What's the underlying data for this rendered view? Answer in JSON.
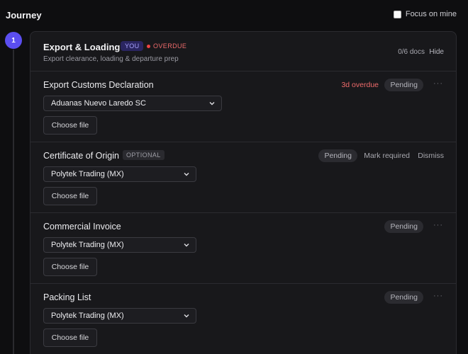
{
  "header": {
    "title": "Journey",
    "focus_label": "Focus on mine"
  },
  "stage": {
    "number": "1",
    "title": "Export & Loading",
    "you_badge": "YOU",
    "overdue_badge": "OVERDUE",
    "subtitle": "Export clearance, loading & departure prep",
    "docs_count": "0/6 docs",
    "hide_label": "Hide"
  },
  "documents": [
    {
      "title": "Export Customs Declaration",
      "overdue": "3d overdue",
      "status": "Pending",
      "selected_party": "Aduanas Nuevo Laredo SC",
      "choose_file": "Choose file"
    },
    {
      "title": "Certificate of Origin",
      "optional_badge": "OPTIONAL",
      "status": "Pending",
      "mark_required": "Mark required",
      "dismiss": "Dismiss",
      "selected_party": "Polytek Trading (MX)",
      "choose_file": "Choose file"
    },
    {
      "title": "Commercial Invoice",
      "status": "Pending",
      "selected_party": "Polytek Trading (MX)",
      "choose_file": "Choose file"
    },
    {
      "title": "Packing List",
      "status": "Pending",
      "selected_party": "Polytek Trading (MX)",
      "choose_file": "Choose file"
    }
  ],
  "colors": {
    "accent": "#5b4ef0",
    "overdue": "#ef4444",
    "background": "#0e0e10",
    "card": "#18181b"
  }
}
